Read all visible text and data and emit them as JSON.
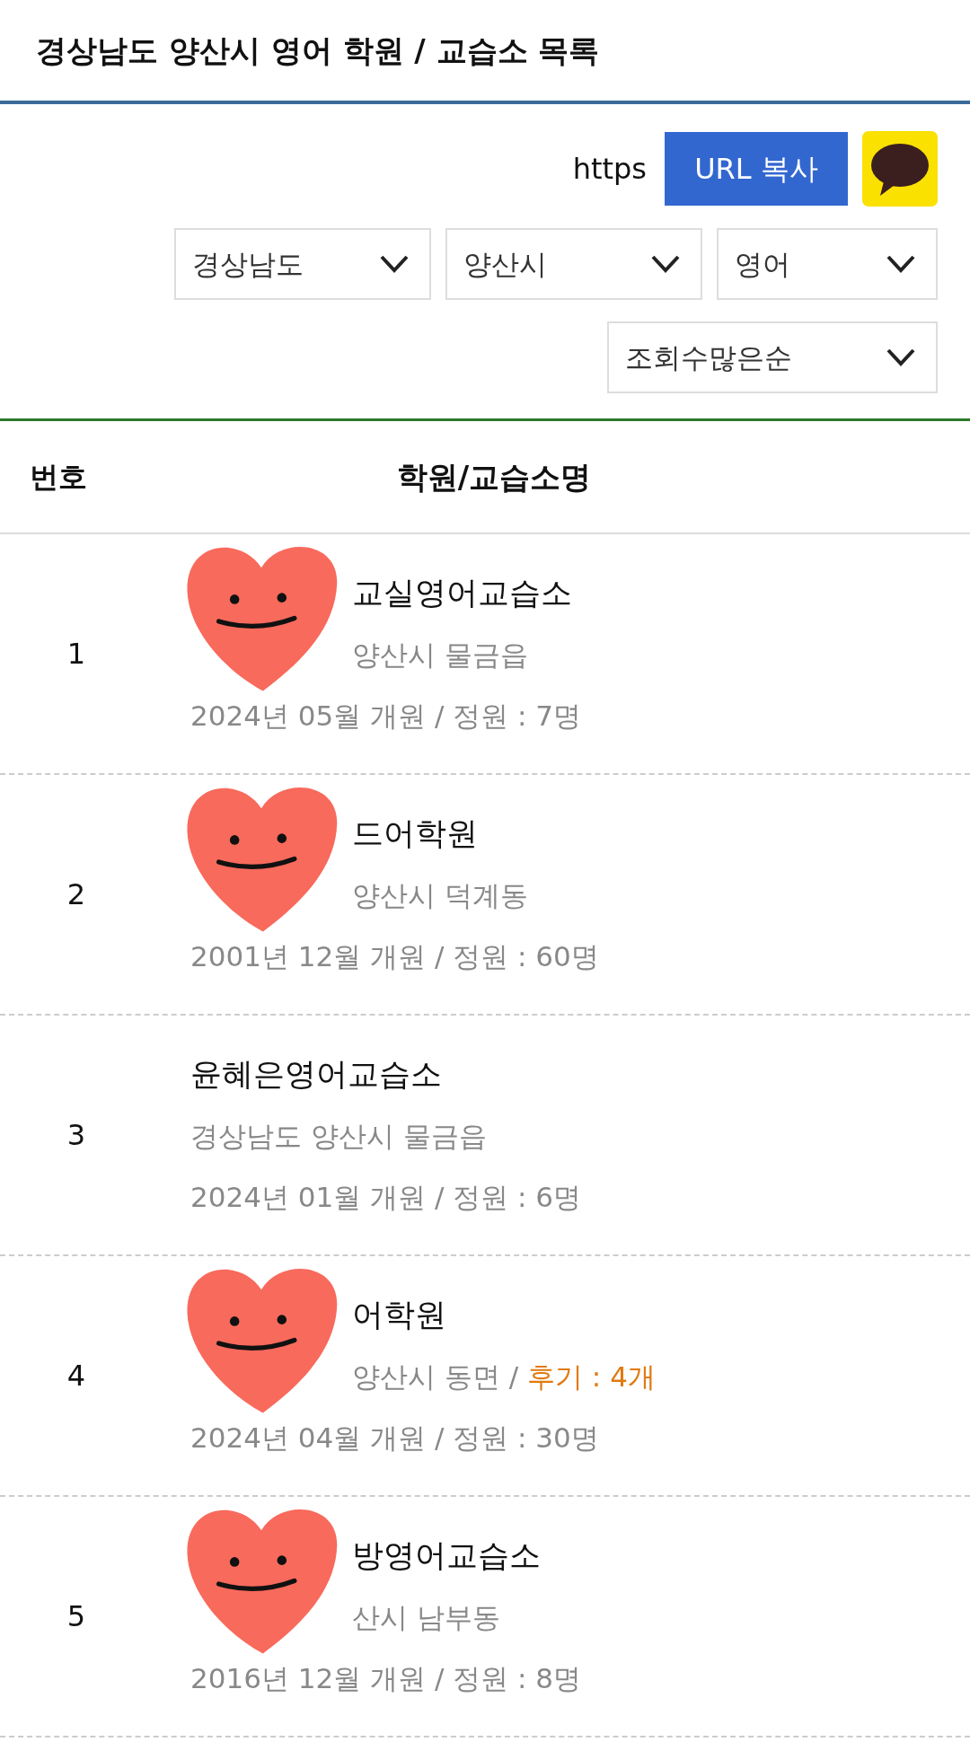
{
  "header": {
    "title": "경상남도 양산시 영어 학원 / 교습소 목록"
  },
  "share": {
    "url": "https",
    "copy_button": "URL 복사"
  },
  "filters": [
    {
      "value": "경상남도"
    },
    {
      "value": "양산시"
    },
    {
      "value": "영어"
    }
  ],
  "sort": {
    "value": "조회수많은순"
  },
  "table": {
    "columns": [
      "번호",
      "학원/교습소명"
    ],
    "rows": [
      {
        "number": "1",
        "name": "교실영어교습소",
        "address": "양산시 물금읍",
        "review": "",
        "opened": "2024년 05월 개원 / 정원 : 7명",
        "covered": true
      },
      {
        "number": "2",
        "name": "드어학원",
        "address": "양산시 덕계동",
        "review": "",
        "opened": "2001년 12월 개원 / 정원 : 60명",
        "covered": true
      },
      {
        "number": "3",
        "name": "윤혜은영어교습소",
        "address": "경상남도 양산시 물금읍",
        "review": "",
        "opened": "2024년 01월 개원 / 정원 : 6명",
        "covered": false
      },
      {
        "number": "4",
        "name": "어학원",
        "address": "양산시 동면 /",
        "review": "후기 : 4개",
        "opened": "2024년 04월 개원 / 정원 : 30명",
        "covered": true
      },
      {
        "number": "5",
        "name": "방영어교습소",
        "address": "산시 남부동",
        "review": "",
        "opened": "2016년 12월 개원 / 정원 : 8명",
        "covered": true
      }
    ]
  }
}
